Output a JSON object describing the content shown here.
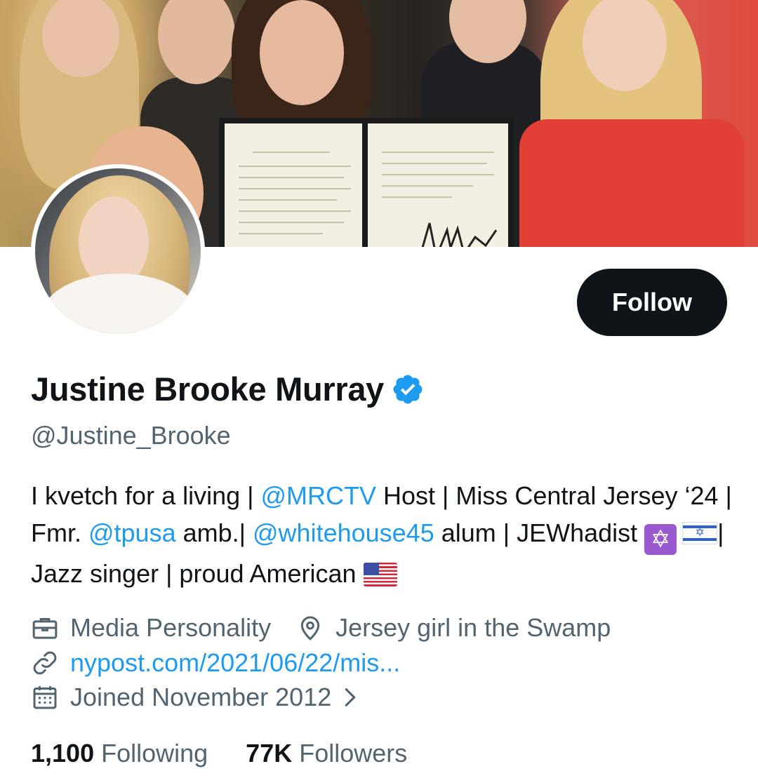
{
  "profile": {
    "display_name": "Justine Brooke Murray",
    "verified": true,
    "handle": "@Justine_Brooke",
    "follow_label": "Follow",
    "bio": {
      "t1": "I kvetch for a living | ",
      "m1": "@MRCTV",
      "t2": " Host | Miss Central Jersey ‘24 | Fmr. ",
      "m2": "@tpusa",
      "t3": " amb.| ",
      "m3": "@whitehouse45",
      "t4": " alum | JEWhadist ",
      "t5": "| Jazz singer | proud American "
    },
    "category": "Media Personality",
    "location": "Jersey girl in the Swamp",
    "website": "nypost.com/2021/06/22/mis...",
    "joined": "Joined November 2012",
    "following_count": "1,100",
    "following_label": "Following",
    "followers_count": "77K",
    "followers_label": "Followers"
  },
  "icons": {
    "category": "briefcase-icon",
    "location": "location-pin-icon",
    "website": "link-icon",
    "joined": "calendar-icon",
    "chevron": "chevron-right-icon",
    "verified": "verified-badge-icon"
  },
  "colors": {
    "accent": "#1d9bf0",
    "secondary_text": "#536471",
    "primary_text": "#0f1419",
    "button_bg": "#0f1419"
  }
}
